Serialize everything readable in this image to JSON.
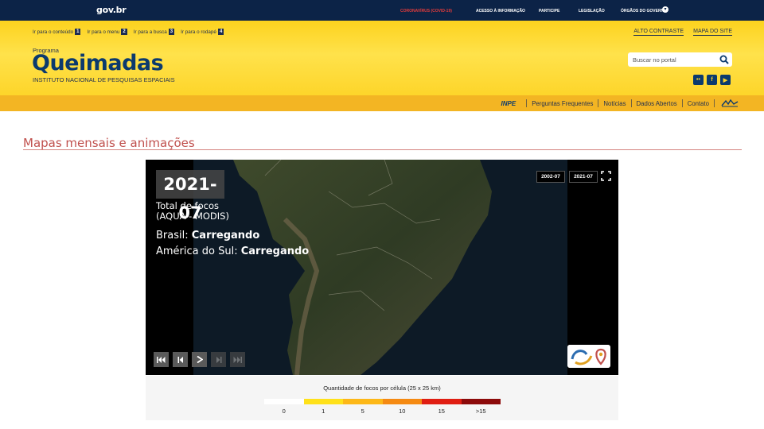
{
  "govbar": {
    "brand": "gov.br",
    "links": [
      "CORONAVÍRUS (COVID-19)",
      "ACESSO À INFORMAÇÃO",
      "PARTICIPE",
      "LEGISLAÇÃO",
      "ÓRGÃOS DO GOVERNO"
    ],
    "covid_color": "#e23b3b"
  },
  "header": {
    "access_links": [
      {
        "label": "Ir para o conteúdo",
        "key": "1"
      },
      {
        "label": "Ir para o menu",
        "key": "2"
      },
      {
        "label": "Ir para a busca",
        "key": "3"
      },
      {
        "label": "Ir para o rodapé",
        "key": "4"
      }
    ],
    "high_contrast": "ALTO CONTRASTE",
    "site_map": "MAPA DO SITE",
    "program": "Programa",
    "title": "Queimadas",
    "subtitle": "INSTITUTO NACIONAL DE PESQUISAS ESPACIAIS",
    "search_placeholder": "Buscar no portal",
    "social": [
      "flickr-icon",
      "facebook-icon",
      "youtube-icon"
    ],
    "brand_color": "#0b3a6e"
  },
  "nav": {
    "inpe": "INPE",
    "items": [
      "Perguntas Frequentes",
      "Notícias",
      "Dados Abertos",
      "Contato"
    ]
  },
  "page": {
    "title": "Mapas mensais e animações",
    "title_color": "#c0504d"
  },
  "viewer": {
    "date": "2021-07",
    "total_label": "Total de focos\n(AQUA - MODIS)",
    "brasil_prefix": "Brasil: ",
    "brasil_value": "Carregando",
    "america_prefix": "América do Sul: ",
    "america_value": "Carregando",
    "range_start": "2002-07",
    "range_end": "2021-07",
    "controls": [
      "first-icon",
      "prev-icon",
      "play-icon",
      "next-icon",
      "last-icon"
    ]
  },
  "legend": {
    "title": "Quantidade de focos por célula (25 x 25 km)",
    "ticks": [
      "0",
      "1",
      "5",
      "10",
      "15",
      ">15"
    ],
    "colors": [
      "#ffffff",
      "#ffe11a",
      "#fdb818",
      "#f58a12",
      "#e01e12",
      "#8c0a0a"
    ]
  }
}
